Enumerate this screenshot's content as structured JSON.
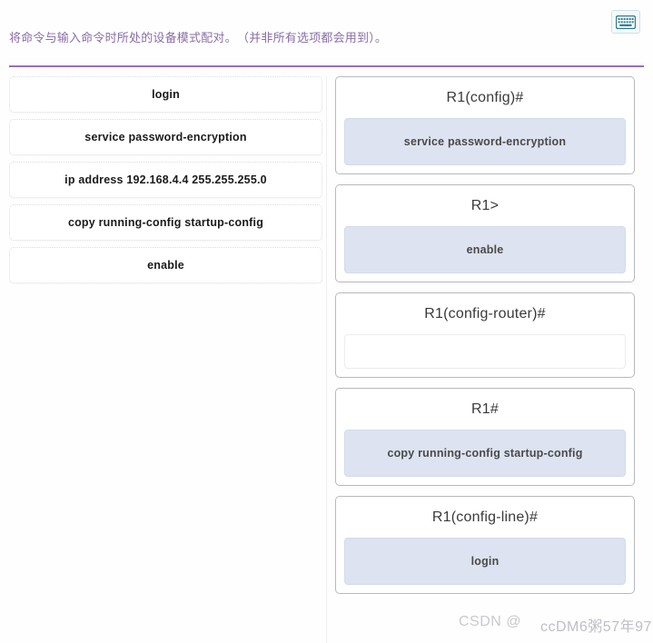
{
  "header": {
    "instruction": "将命令与输入命令时所处的设备模式配对。　（并非所有选项都会用到）。",
    "keyboard_icon": "keyboard-icon",
    "instruction_color": "#8a6fa8",
    "divider_color": "#9b6fb5"
  },
  "left_panel": {
    "commands": [
      {
        "label": "login"
      },
      {
        "label": "service password-encryption"
      },
      {
        "label": "ip address 192.168.4.4 255.255.255.0"
      },
      {
        "label": "copy running-config startup-config"
      },
      {
        "label": "enable"
      }
    ]
  },
  "right_panel": {
    "modes": [
      {
        "prompt": "R1(config)#",
        "dropped": "service password-encryption",
        "filled": true
      },
      {
        "prompt": "R1>",
        "dropped": "enable",
        "filled": true
      },
      {
        "prompt": "R1(config-router)#",
        "dropped": "",
        "filled": false
      },
      {
        "prompt": "R1#",
        "dropped": "copy running-config startup-config",
        "filled": true
      },
      {
        "prompt": "R1(config-line)#",
        "dropped": "login",
        "filled": true
      }
    ],
    "slot_fill_color": "#dde3f0"
  },
  "watermark": {
    "text_a": "CSDN @",
    "text_b": "ccDM6粥57年97"
  }
}
